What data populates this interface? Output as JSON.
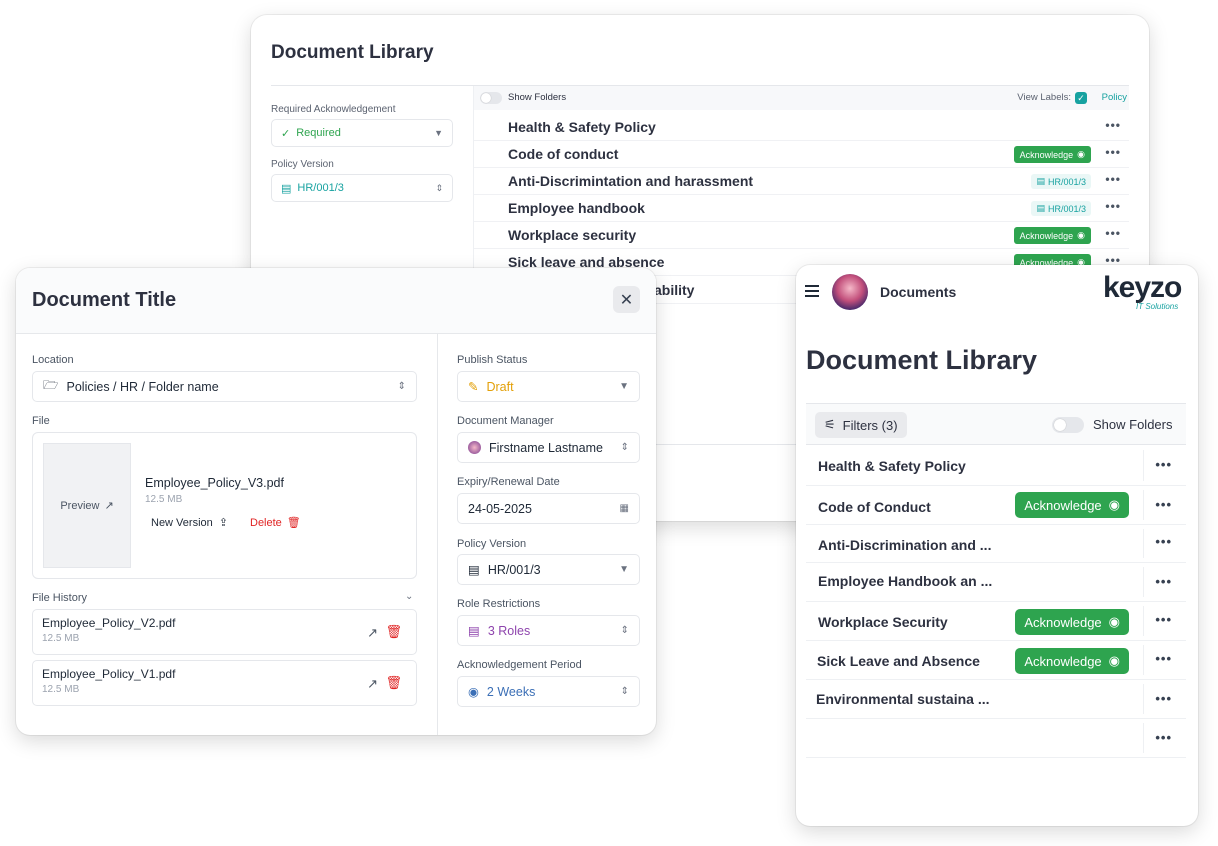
{
  "desktop": {
    "title": "Document Library",
    "filters": {
      "required_label": "Required Acknowledgement",
      "required_value": "Required",
      "version_label": "Policy Version",
      "version_value": "HR/001/3"
    },
    "toolbar": {
      "show_folders": "Show Folders",
      "view_labels": "View Labels:",
      "policy": "Policy"
    },
    "rows": [
      {
        "name": "Health & Safety Policy",
        "badge": ""
      },
      {
        "name": "Code of conduct",
        "badge": "Acknowledge"
      },
      {
        "name": "Anti-Discrimintation and harassment",
        "badge": "HR/001/3"
      },
      {
        "name": "Employee handbook",
        "badge": "HR/001/3"
      },
      {
        "name": "Workplace security",
        "badge": "Acknowledge"
      },
      {
        "name": "Sick leave and absence",
        "badge": "Acknowledge"
      },
      {
        "name": "ability",
        "badge": ""
      }
    ]
  },
  "modal": {
    "title": "Document Title",
    "location_label": "Location",
    "location_value": "Policies / HR / Folder name",
    "file_label": "File",
    "preview": "Preview",
    "file_name": "Employee_Policy_V3.pdf",
    "file_size": "12.5 MB",
    "new_version": "New Version",
    "delete": "Delete",
    "history_label": "File History",
    "history": [
      {
        "name": "Employee_Policy_V2.pdf",
        "size": "12.5 MB"
      },
      {
        "name": "Employee_Policy_V1.pdf",
        "size": "12.5 MB"
      }
    ],
    "publish_label": "Publish Status",
    "publish_value": "Draft",
    "manager_label": "Document Manager",
    "manager_value": "Firstname Lastname",
    "expiry_label": "Expiry/Renewal Date",
    "expiry_value": "24-05-2025",
    "version_label": "Policy Version",
    "version_value": "HR/001/3",
    "roles_label": "Role Restrictions",
    "roles_value": "3 Roles",
    "ack_label": "Acknowledgement Period",
    "ack_value": "2 Weeks"
  },
  "mobile": {
    "nav_title": "Documents",
    "logo": "keyzo",
    "logo_sub": "IT Solutions",
    "title": "Document Library",
    "filters_btn": "Filters (3)",
    "show_folders": "Show Folders",
    "ack_label": "Acknowledge",
    "rows": [
      {
        "name": "Health & Safety Policy"
      },
      {
        "name": "Code of Conduct"
      },
      {
        "name": "Anti-Discrimination and ..."
      },
      {
        "name": "Employee Handbook an ..."
      },
      {
        "name": "Workplace Security"
      },
      {
        "name": "Sick Leave and Absence"
      },
      {
        "name": "Environmental sustaina ..."
      },
      {
        "name": ""
      }
    ]
  },
  "colors": {
    "accent_green": "#2ea44f",
    "accent_teal": "#17a2a0",
    "draft_orange": "#e3a008",
    "roles_purple": "#8e44ad",
    "delete_red": "#e02424"
  }
}
